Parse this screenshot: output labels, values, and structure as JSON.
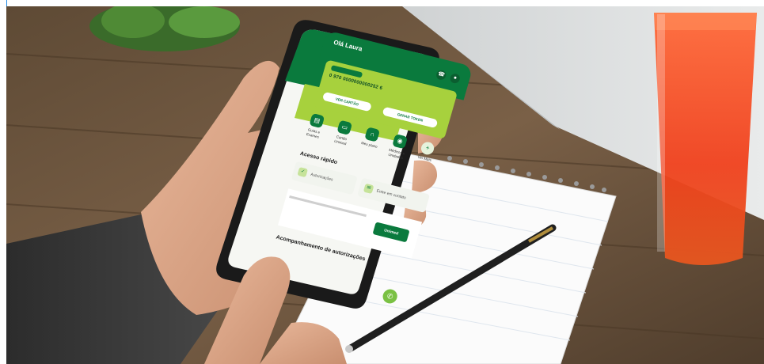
{
  "app": {
    "greeting": "Olá Laura",
    "greeting_sub": "",
    "card": {
      "tag": "",
      "number": "0 970 0000000000252 6",
      "btn_left": "VER CARTÃO",
      "btn_right": "GERAR TOKEN"
    },
    "services": [
      {
        "label": "Guias e Exames",
        "icon": "document-icon"
      },
      {
        "label": "Cartão Unimed",
        "icon": "card-icon"
      },
      {
        "label": "Meu plano",
        "icon": "plan-icon"
      },
      {
        "label": "Médicos e Unidades",
        "icon": "location-icon"
      },
      {
        "label": "Ver Mais",
        "icon": "plus-icon"
      }
    ],
    "quick_title": "Acesso rápido",
    "quick_items": [
      {
        "label": "Autorizações",
        "icon": "authorization-icon"
      },
      {
        "label": "Entre em contato",
        "icon": "contact-icon"
      }
    ],
    "banner_badge": "Unimed",
    "tracking_title": "Acompanhamento de autorizações"
  },
  "colors": {
    "brand_green": "#0a7a3d",
    "lime": "#a7d13d",
    "chat": "#7ac143"
  }
}
